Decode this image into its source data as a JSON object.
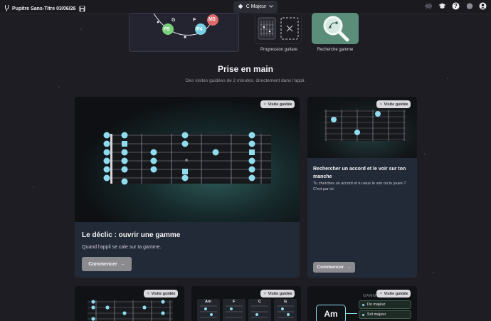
{
  "topbar": {
    "title": "Pupitre Sans-Titre 03/06/26",
    "key_label": "C Majeur"
  },
  "hero": {
    "notes": [
      "G",
      "F",
      "M3",
      "P5",
      "P4"
    ]
  },
  "tools": [
    {
      "label": "Progression guitare"
    },
    {
      "label": "Recherche gamme"
    }
  ],
  "section": {
    "title": "Prise en main",
    "subtitle": "Des visites guidées de 2 minutes, directement dans l'appli."
  },
  "cards": [
    {
      "badge": "Visite guidée",
      "title": "Le déclic : ouvrir une gamme",
      "description": "Quand l'appli se cale sur ta gamme.",
      "button": "Commencer"
    },
    {
      "badge": "Visite guidée",
      "title": "Rechercher un accord et le voir sur ton manche",
      "description": "Tu cherches un accord et tu veux le voir où tu joues ? C'est par ici.",
      "button": "Commencer"
    },
    {
      "badge": "Visite guidée"
    },
    {
      "badge": "Visite guidée",
      "chords": [
        "Am",
        "F",
        "C",
        "G"
      ]
    },
    {
      "badge": "Visite guidée",
      "chip": "Am",
      "list_header": "GAMME",
      "items": [
        "Do majeur",
        "Sol majeur"
      ]
    }
  ],
  "colors": {
    "accent": "#8fdcef",
    "card_bg": "#232a37",
    "page_bg": "#1d1d23",
    "button_bg": "#8a8a8f"
  }
}
